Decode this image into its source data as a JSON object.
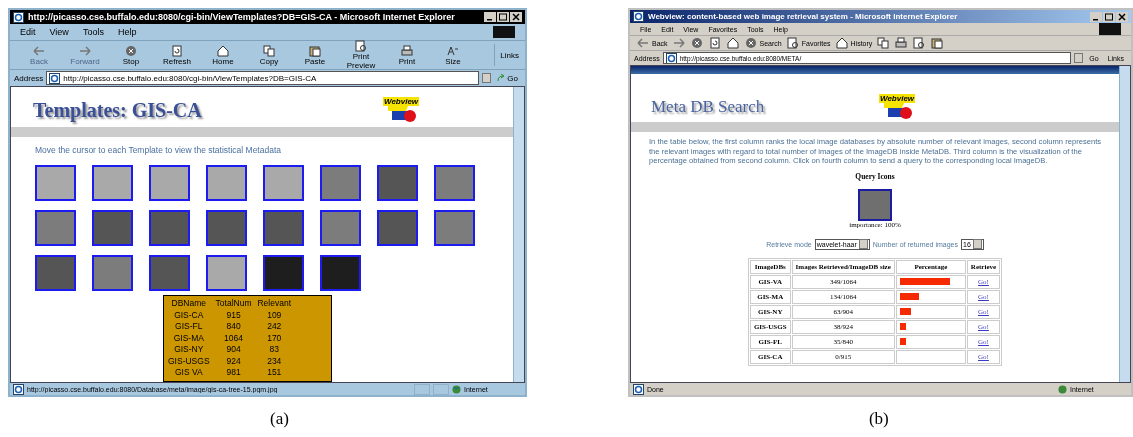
{
  "window_a": {
    "title": "http://picasso.cse.buffalo.edu:8080/cgi-bin/ViewTemplates?DB=GIS-CA - Microsoft Internet Explorer",
    "menu": [
      "Edit",
      "View",
      "Tools",
      "Help"
    ],
    "toolbar": [
      {
        "label": "Back",
        "disabled": true
      },
      {
        "label": "Forward",
        "disabled": true
      },
      {
        "label": "Stop",
        "disabled": false
      },
      {
        "label": "Refresh",
        "disabled": false
      },
      {
        "label": "Home",
        "disabled": false
      },
      {
        "label": "Copy",
        "disabled": false
      },
      {
        "label": "Paste",
        "disabled": false
      },
      {
        "label": "Print Preview",
        "disabled": false
      },
      {
        "label": "Print",
        "disabled": false
      },
      {
        "label": "Size",
        "disabled": false
      }
    ],
    "links": "Links",
    "address_label": "Address",
    "address": "http://picasso.cse.buffalo.edu:8080/cgi-bin/ViewTemplates?DB=GIS-CA",
    "go": "Go",
    "heading": "Templates: GIS-CA",
    "logo_text": "Webview",
    "instruction": "Move the cursor to each Template to view the statistical Metadata",
    "thumbnails": [
      {
        "kind": "light"
      },
      {
        "kind": "light"
      },
      {
        "kind": "light"
      },
      {
        "kind": "light"
      },
      {
        "kind": "light"
      },
      {
        "kind": "mid"
      },
      {
        "kind": "dark"
      },
      {
        "kind": "mid"
      },
      {
        "kind": "mid"
      },
      {
        "kind": "dark"
      },
      {
        "kind": "dark"
      },
      {
        "kind": "dark"
      },
      {
        "kind": "dark"
      },
      {
        "kind": "mid"
      },
      {
        "kind": "dark"
      },
      {
        "kind": "mid"
      },
      {
        "kind": "dark"
      },
      {
        "kind": "mid"
      },
      {
        "kind": "dark"
      },
      {
        "kind": "light"
      },
      {
        "kind": "black"
      },
      {
        "kind": "black"
      }
    ],
    "popup": {
      "columns": [
        "DBName",
        "TotalNum",
        "Relevant"
      ],
      "rows": [
        [
          "GIS-CA",
          "915",
          "109"
        ],
        [
          "GIS-FL",
          "840",
          "242"
        ],
        [
          "GIS-MA",
          "1064",
          "170"
        ],
        [
          "GIS-NY",
          "904",
          "83"
        ],
        [
          "GIS-USGS",
          "924",
          "234"
        ],
        [
          "GIS VA",
          "981",
          "151"
        ]
      ]
    },
    "status": "http://picasso.cse.buffalo.edu:8080/Database/meta/image/gis-ca-tree-15.pgm.jpg",
    "zone": "Internet"
  },
  "window_b": {
    "title": "Webview: content-based web image retrieval system - Microsoft Internet Explorer",
    "menu": [
      "File",
      "Edit",
      "View",
      "Favorites",
      "Tools",
      "Help"
    ],
    "toolbar": [
      "Back",
      "Search",
      "Favorites",
      "History"
    ],
    "address_label": "Address",
    "address": "http://picasso.cse.buffalo.edu:8080/META/",
    "go": "Go",
    "links": "Links",
    "heading": "Meta DB Search",
    "logo_text": "Webview",
    "description": "In the table below, the first column ranks the local image databases by absolute number of relevant images, second column represents the relevant images with regard to total number of images of the ImageDB inside MetaDB. Third column is the visualization of the percentage obtained from second column. Click on fourth column to send a query to the corresponding local ImageDB.",
    "query_title": "Query Icons",
    "importance": "importance: 100%",
    "retrieve_mode_label": "Retrieve mode",
    "retrieve_mode": "wavelet-haar",
    "count_label": "Number of returned images",
    "count": "16",
    "table": {
      "columns": [
        "ImageDBs",
        "Images Retrieved/ImageDB size",
        "Percentage",
        "Retrieve"
      ],
      "rows": [
        {
          "db": "GIS-VA",
          "ratio": "349/1064",
          "level": 0.81,
          "action": "Go!"
        },
        {
          "db": "GIS-MA",
          "ratio": "134/1064",
          "level": 0.31,
          "action": "Go!"
        },
        {
          "db": "GIS-NY",
          "ratio": "63/904",
          "level": 0.18,
          "action": "Go!"
        },
        {
          "db": "GIS-USGS",
          "ratio": "38/924",
          "level": 0.1,
          "action": "Go!"
        },
        {
          "db": "GIS-FL",
          "ratio": "35/840",
          "level": 0.1,
          "action": "Go!"
        },
        {
          "db": "GIS-CA",
          "ratio": "0/915",
          "level": 0,
          "action": "Go!"
        }
      ]
    },
    "status": "Done",
    "zone": "Internet"
  },
  "captions": [
    "(a)",
    "(b)"
  ]
}
